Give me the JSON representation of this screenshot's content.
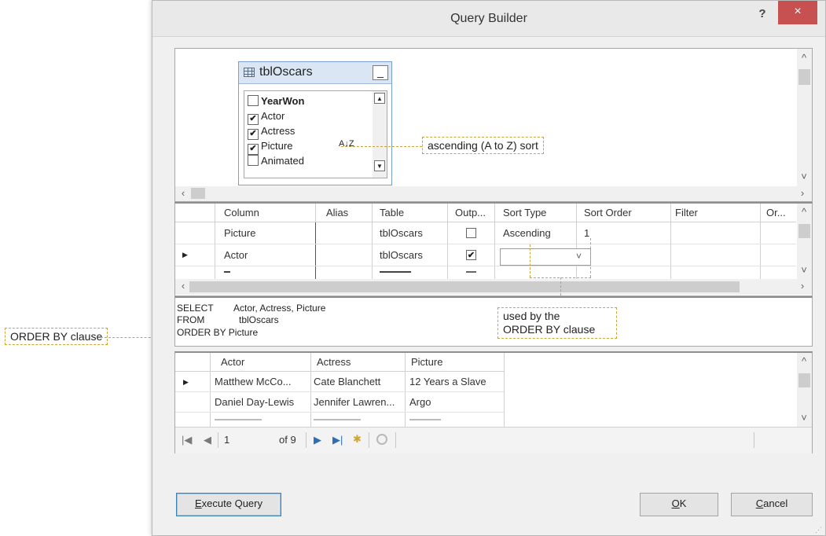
{
  "window": {
    "title": "Query Builder",
    "help": "?",
    "close": "×"
  },
  "table_widget": {
    "title": "tblOscars",
    "minimize": "_",
    "fields": [
      {
        "name": "YearWon",
        "checked": false,
        "bold": true
      },
      {
        "name": "Actor",
        "checked": true
      },
      {
        "name": "Actress",
        "checked": true
      },
      {
        "name": "Picture",
        "checked": true,
        "sort_icon": "A↓Z"
      },
      {
        "name": "Animated",
        "checked": false
      }
    ]
  },
  "grid": {
    "columns": [
      "Column",
      "Alias",
      "Table",
      "Outp...",
      "Sort Type",
      "Sort Order",
      "Filter",
      "Or..."
    ],
    "rows": [
      {
        "column": "Picture",
        "alias": "",
        "table": "tblOscars",
        "output": false,
        "sort_type": "Ascending",
        "sort_order": "1"
      },
      {
        "column": "Actor",
        "alias": "",
        "table": "tblOscars",
        "output": true,
        "sort_type": "",
        "sort_order": ""
      }
    ]
  },
  "sql": {
    "line1_kw": "SELECT",
    "line1_val": "Actor, Actress, Picture",
    "line2_kw": "FROM",
    "line2_val": "tblOscars",
    "line3": "ORDER BY Picture"
  },
  "results": {
    "columns": [
      "Actor",
      "Actress",
      "Picture"
    ],
    "rows": [
      [
        "Matthew McCo...",
        "Cate Blanchett",
        "12 Years a Slave"
      ],
      [
        "Daniel Day-Lewis",
        "Jennifer Lawren...",
        "Argo"
      ]
    ],
    "nav": {
      "current": "1",
      "of_label": "of 9"
    }
  },
  "buttons": {
    "execute_prefix": "E",
    "execute_rest": "xecute Query",
    "ok_prefix": "O",
    "ok_rest": "K",
    "cancel_prefix": "C",
    "cancel_rest": "ancel"
  },
  "callouts": {
    "sort": "ascending (A to Z) sort",
    "order_by_clause": "ORDER BY clause",
    "used_by_1": "used by the",
    "used_by_2": "ORDER BY clause"
  },
  "colors": {
    "callout_border": "#c9a636",
    "close_button": "#c75050",
    "accent": "#3c7fb1"
  }
}
